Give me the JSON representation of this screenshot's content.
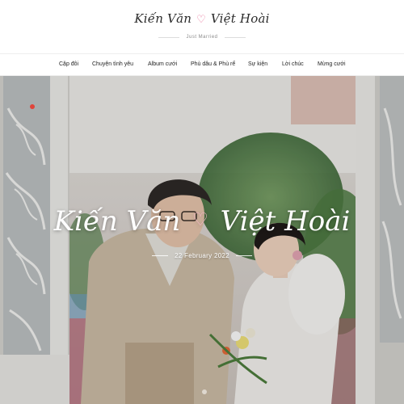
{
  "header": {
    "logo_part1": "Kiến Văn",
    "logo_heart": "♡",
    "logo_part2": "Việt Hoài",
    "subtitle": "Just Married"
  },
  "nav": {
    "items": [
      {
        "label": "Cặp đôi"
      },
      {
        "label": "Chuyện tình yêu"
      },
      {
        "label": "Album cưới"
      },
      {
        "label": "Phù dâu & Phù rể"
      },
      {
        "label": "Sự kiện"
      },
      {
        "label": "Lời chúc"
      },
      {
        "label": "Mừng cưới"
      }
    ]
  },
  "hero": {
    "title_part1": "Kiến Văn",
    "title_heart": "♡",
    "title_part2": "Việt Hoài",
    "date": "22 February 2022"
  },
  "colors": {
    "accent_pink": "#e8739a",
    "indicator_red": "#e0443a"
  }
}
